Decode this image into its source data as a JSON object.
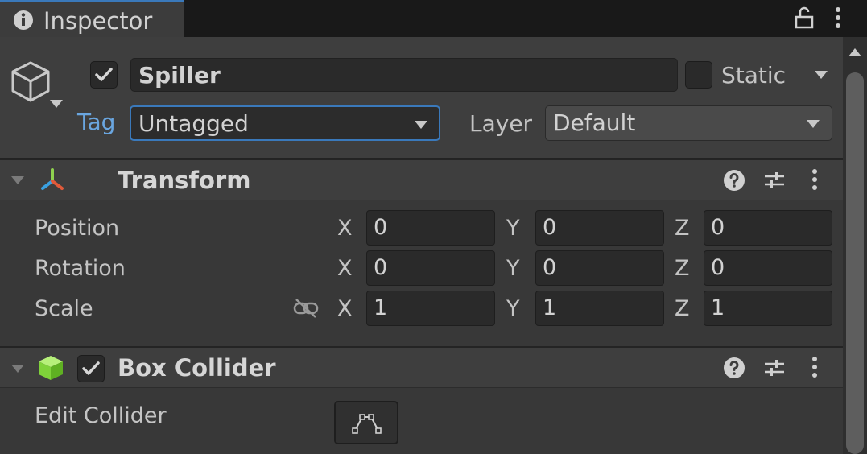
{
  "window": {
    "tab_title": "Inspector"
  },
  "gameobject": {
    "name": "Spiller",
    "active": true,
    "static_label": "Static",
    "tag_label": "Tag",
    "tag_value": "Untagged",
    "layer_label": "Layer",
    "layer_value": "Default"
  },
  "transform": {
    "title": "Transform",
    "rows": [
      {
        "label": "Position",
        "x": "0",
        "y": "0",
        "z": "0"
      },
      {
        "label": "Rotation",
        "x": "0",
        "y": "0",
        "z": "0"
      },
      {
        "label": "Scale",
        "x": "1",
        "y": "1",
        "z": "1"
      }
    ],
    "axis_x": "X",
    "axis_y": "Y",
    "axis_z": "Z"
  },
  "box_collider": {
    "title": "Box Collider",
    "enabled": true,
    "edit_label": "Edit Collider"
  },
  "colors": {
    "accent": "#3a79bb",
    "tag_label": "#6aa6e0",
    "transform_gizmo_x": "#e05a3a",
    "transform_gizmo_y": "#8fd14f",
    "transform_gizmo_z": "#3aa0e0",
    "collider_green": "#8fe04a"
  },
  "icons": {
    "tab": "info-icon",
    "lock": "lock-icon",
    "menu": "kebab-menu-icon",
    "object": "cube-outline-icon",
    "help": "help-icon",
    "presets": "sliders-icon",
    "link": "unlinked-chain-icon",
    "edit": "edit-collider-icon"
  }
}
